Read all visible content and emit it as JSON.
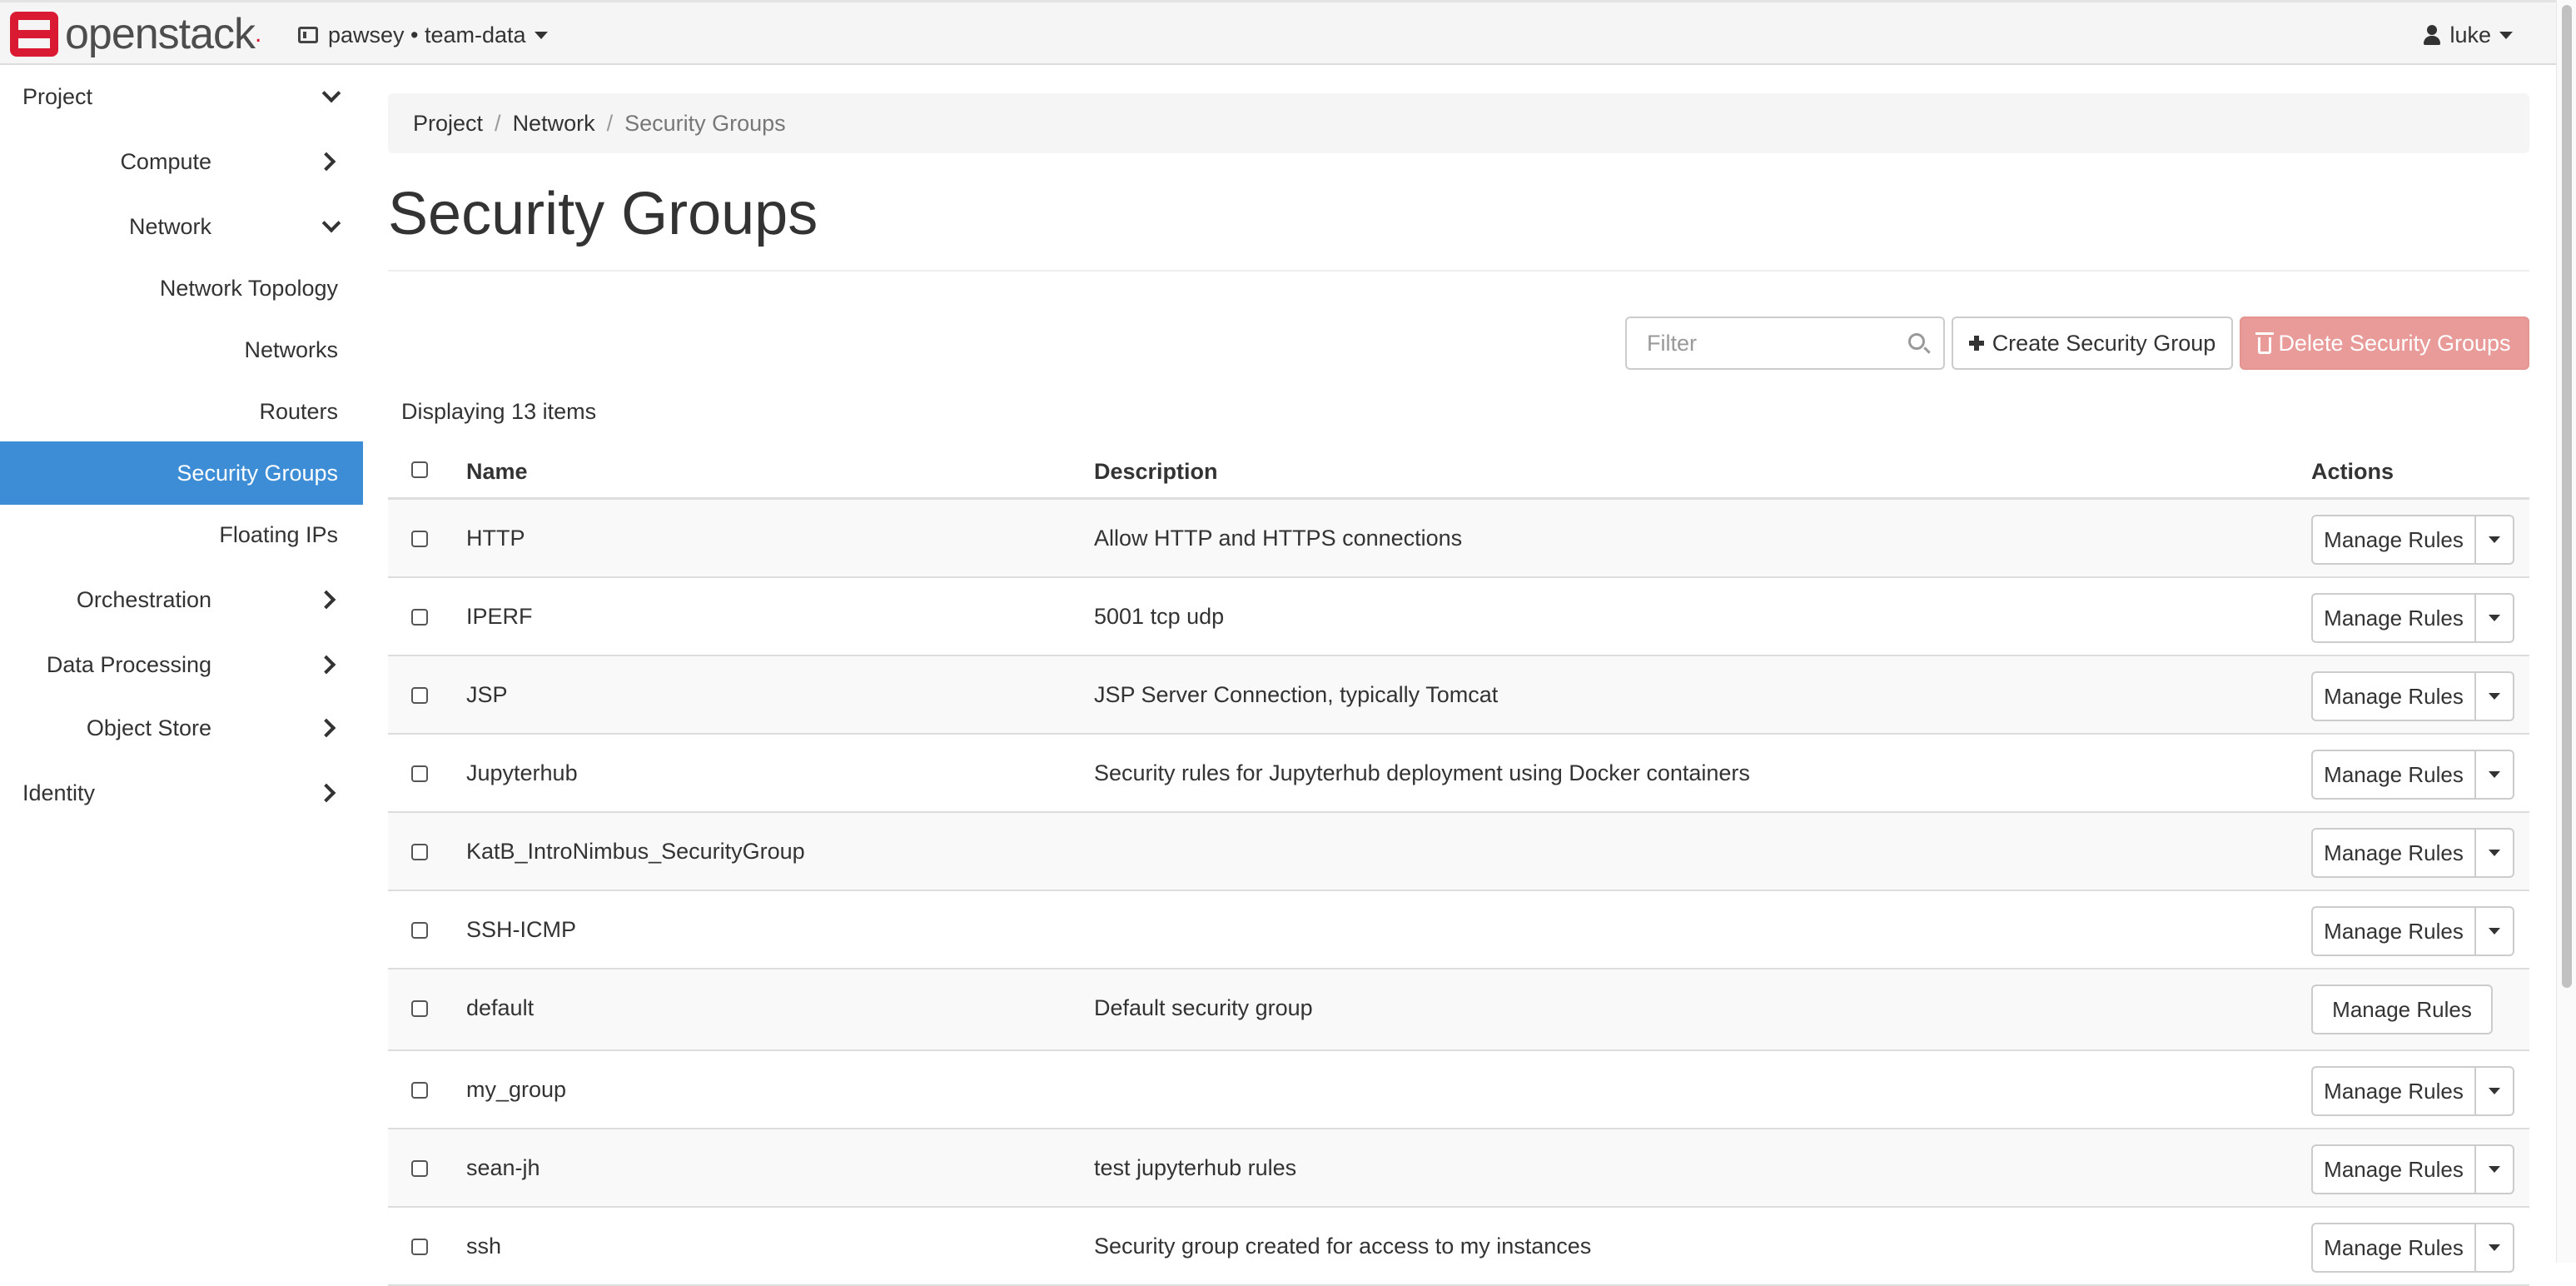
{
  "topbar": {
    "brand": "openstack",
    "project_label": "pawsey • team-data",
    "user_label": "luke"
  },
  "sidebar": {
    "project": "Project",
    "compute": "Compute",
    "network": "Network",
    "network_topology": "Network Topology",
    "networks": "Networks",
    "routers": "Routers",
    "security_groups": "Security Groups",
    "floating_ips": "Floating IPs",
    "orchestration": "Orchestration",
    "data_processing": "Data Processing",
    "object_store": "Object Store",
    "identity": "Identity"
  },
  "breadcrumb": {
    "project": "Project",
    "network": "Network",
    "current": "Security Groups"
  },
  "page": {
    "title": "Security Groups",
    "filter_placeholder": "Filter",
    "create_label": "Create Security Group",
    "delete_label": "Delete Security Groups",
    "count_text": "Displaying 13 items"
  },
  "table": {
    "headers": {
      "name": "Name",
      "description": "Description",
      "actions": "Actions"
    },
    "manage_label": "Manage Rules",
    "rows": [
      {
        "name": "HTTP",
        "description": "Allow HTTP and HTTPS connections"
      },
      {
        "name": "IPERF",
        "description": "5001 tcp udp"
      },
      {
        "name": "JSP",
        "description": "JSP Server Connection, typically Tomcat"
      },
      {
        "name": "Jupyterhub",
        "description": "Security rules for Jupyterhub deployment using Docker containers"
      },
      {
        "name": "KatB_IntroNimbus_SecurityGroup",
        "description": ""
      },
      {
        "name": "SSH-ICMP",
        "description": ""
      },
      {
        "name": "default",
        "description": "Default security group"
      },
      {
        "name": "my_group",
        "description": ""
      },
      {
        "name": "sean-jh",
        "description": "test jupyterhub rules"
      },
      {
        "name": "ssh",
        "description": "Security group created for access to my instances"
      }
    ]
  },
  "colors": {
    "active_nav": "#3c8dd5",
    "delete_button": "#e99b99",
    "brand_red": "#da1a32"
  }
}
